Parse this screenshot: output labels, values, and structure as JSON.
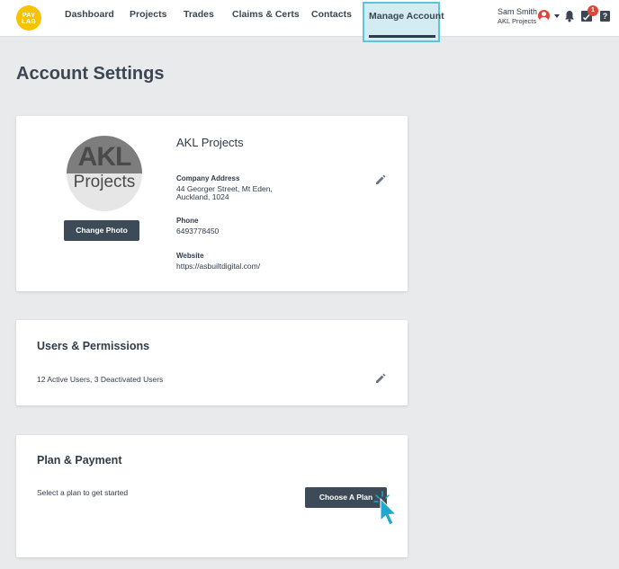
{
  "header": {
    "logo": {
      "line1": "PAY",
      "line2": "LAB",
      "color": "#f7c300"
    },
    "nav": [
      {
        "label": "Dashboard"
      },
      {
        "label": "Projects"
      },
      {
        "label": "Trades"
      },
      {
        "label": "Claims & Certs"
      },
      {
        "label": "Contacts"
      },
      {
        "label": "Manage Account",
        "active": true
      }
    ],
    "user": {
      "name": "Sam Smith",
      "company": "AKL Projects"
    },
    "notifications_badge": "1",
    "help_label": "?"
  },
  "page": {
    "title": "Account Settings"
  },
  "profile": {
    "photo_text_line1": "AKL",
    "photo_text_line2": "Projects",
    "change_photo_label": "Change Photo",
    "company_name": "AKL Projects",
    "address_label": "Company Address",
    "address_line1": "44 Georger Street, Mt Eden,",
    "address_line2": "Auckland, 1024",
    "phone_label": "Phone",
    "phone_value": "6493778450",
    "website_label": "Website",
    "website_value": "https://asbuiltdigital.com/"
  },
  "users": {
    "title": "Users & Permissions",
    "summary": "12 Active Users, 3 Deactivated Users"
  },
  "plan": {
    "title": "Plan & Payment",
    "description": "Select a plan to get started",
    "choose_label": "Choose A Plan"
  },
  "colors": {
    "accent": "#5ec4dc",
    "active_tab_bg": "#d3ecf2",
    "button": "#3d4b59",
    "badge": "#e0443a",
    "cursor": "#21a8d0"
  }
}
